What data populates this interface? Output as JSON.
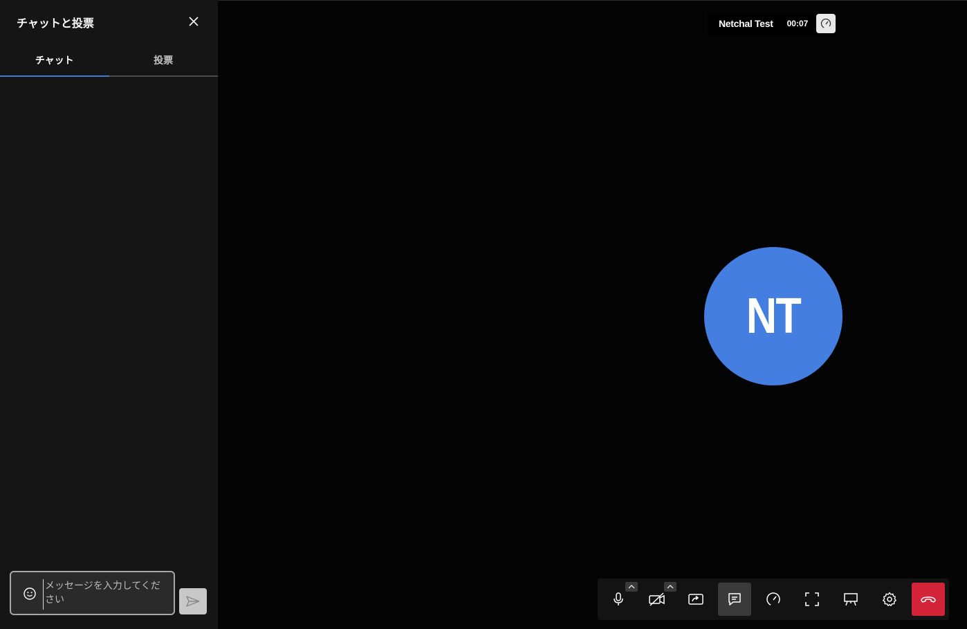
{
  "sidebar": {
    "title": "チャットと投票",
    "tabs": [
      {
        "label": "チャット",
        "active": true
      },
      {
        "label": "投票",
        "active": false
      }
    ],
    "composer": {
      "placeholder": "メッセージを入力してください"
    }
  },
  "main": {
    "meeting_name": "Netchal Test",
    "timer": "00:07",
    "participant_initials": "NT",
    "avatar_color": "#437ee0",
    "toolbar": [
      {
        "name": "microphone-icon"
      },
      {
        "name": "camera-off-icon"
      },
      {
        "name": "share-screen-icon"
      },
      {
        "name": "chat-icon",
        "active": true
      },
      {
        "name": "performance-icon"
      },
      {
        "name": "fullscreen-icon"
      },
      {
        "name": "whiteboard-icon"
      },
      {
        "name": "settings-icon"
      },
      {
        "name": "hangup-icon",
        "color": "#d22339"
      }
    ]
  }
}
